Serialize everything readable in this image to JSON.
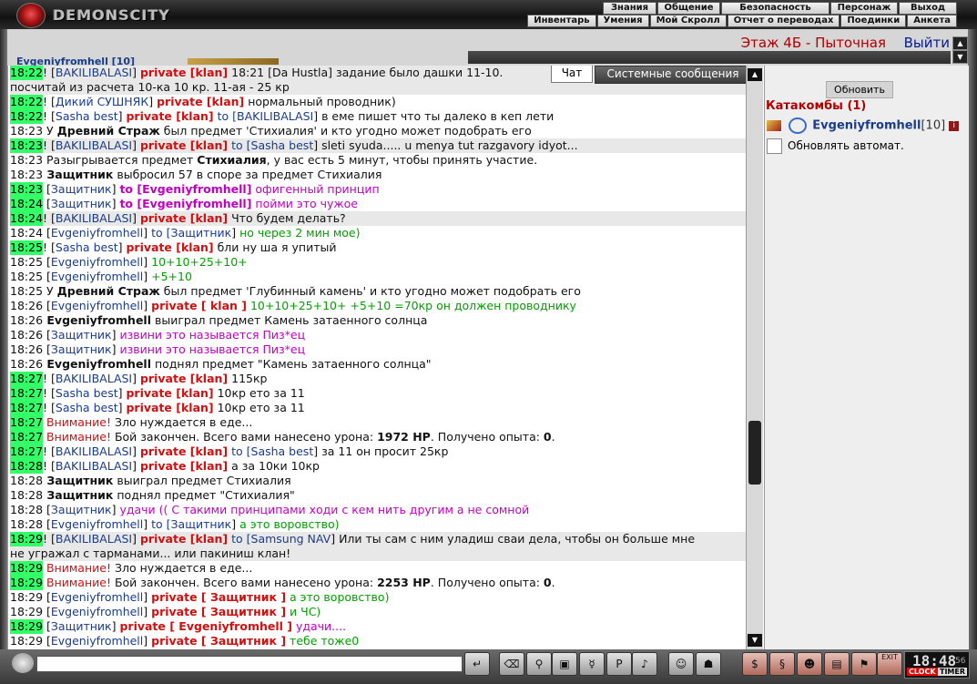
{
  "header": {
    "logo_text": "DEMONSCITY",
    "menu_top": [
      "Знания",
      "Общение",
      "Безопасность",
      "Персонаж",
      "Выход"
    ],
    "menu_bottom": [
      "Инвентарь",
      "Умения",
      "Мой Скролл",
      "Отчет о переводах",
      "Поединки",
      "Анкета"
    ],
    "user_line": "Evgeniyfromhell [10]",
    "location_title": "Этаж 4Б - Пыточная",
    "exit_label": "Выйти"
  },
  "tabs": {
    "chat": "Чат",
    "system": "Системные сообщения"
  },
  "chat": [
    {
      "hl": true,
      "alt": true,
      "parts": [
        [
          "t",
          "18:22"
        ],
        [
          "",
          "! ["
        ],
        [
          "nk",
          "BAKILIBALASI"
        ],
        [
          "",
          "] "
        ],
        [
          "pv",
          "private [klan]"
        ],
        [
          "",
          " 18:21 [Da Hustla] задание было дашки 11-10."
        ]
      ]
    },
    {
      "hl": false,
      "alt": true,
      "parts": [
        [
          "",
          "посчитай из расчета 10-ка 10 кр. 11-ая - 25 кр"
        ]
      ]
    },
    {
      "hl": true,
      "alt": false,
      "parts": [
        [
          "t",
          "18:22"
        ],
        [
          "",
          "! ["
        ],
        [
          "nk",
          "Дикий СУШНЯК"
        ],
        [
          "",
          "] "
        ],
        [
          "pv",
          "private [klan]"
        ],
        [
          "",
          " нормальный проводник)"
        ]
      ]
    },
    {
      "hl": true,
      "alt": false,
      "parts": [
        [
          "t",
          "18:22"
        ],
        [
          "",
          "! ["
        ],
        [
          "nk",
          "Sasha best"
        ],
        [
          "",
          "] "
        ],
        [
          "pv",
          "private [klan]"
        ],
        [
          "to",
          " to ["
        ],
        [
          "nk",
          "BAKILIBALASI"
        ],
        [
          "",
          "] в еме пишет что ты далеко в кеп лети"
        ]
      ]
    },
    {
      "hl": false,
      "alt": false,
      "parts": [
        [
          "t",
          "18:23"
        ],
        [
          "",
          " У "
        ],
        [
          "bold",
          "Древний Страж"
        ],
        [
          "",
          " был предмет 'Стихиалия' и кто угодно может подобрать его"
        ]
      ]
    },
    {
      "hl": true,
      "alt": true,
      "parts": [
        [
          "t",
          "18:23"
        ],
        [
          "",
          "! ["
        ],
        [
          "nk",
          "BAKILIBALASI"
        ],
        [
          "",
          "] "
        ],
        [
          "pv",
          "private [klan]"
        ],
        [
          "to",
          " to ["
        ],
        [
          "nk",
          "Sasha best"
        ],
        [
          "",
          "] sleti syuda..... u menya tut razgavory idyot..."
        ]
      ]
    },
    {
      "hl": false,
      "alt": false,
      "parts": [
        [
          "t",
          "18:23"
        ],
        [
          "",
          " Разыгрывается предмет "
        ],
        [
          "bold",
          "Стихиалия"
        ],
        [
          "",
          ", у вас есть 5 минут, чтобы принять участие."
        ]
      ]
    },
    {
      "hl": false,
      "alt": false,
      "parts": [
        [
          "t",
          "18:23"
        ],
        [
          "",
          ""
        ],
        [
          "bold",
          " Защитник"
        ],
        [
          "",
          " выбросил 57 в споре за предмет Стихиалия"
        ]
      ]
    },
    {
      "hl": true,
      "alt": false,
      "parts": [
        [
          "t",
          "18:23"
        ],
        [
          "",
          " ["
        ],
        [
          "nk",
          "Защитник"
        ],
        [
          "",
          "] "
        ],
        [
          "pvm",
          "to ["
        ],
        [
          "pvm",
          "Evgeniyfromhell"
        ],
        [
          "pvm",
          "]"
        ],
        [
          "mg",
          " офигенный принцип"
        ]
      ]
    },
    {
      "hl": true,
      "alt": false,
      "parts": [
        [
          "t",
          "18:24"
        ],
        [
          "",
          " ["
        ],
        [
          "nk",
          "Защитник"
        ],
        [
          "",
          "] "
        ],
        [
          "pvm",
          "to ["
        ],
        [
          "pvm",
          "Evgeniyfromhell"
        ],
        [
          "pvm",
          "]"
        ],
        [
          "mg",
          " пойми это чужое"
        ]
      ]
    },
    {
      "hl": true,
      "alt": true,
      "parts": [
        [
          "t",
          "18:24"
        ],
        [
          "",
          "! ["
        ],
        [
          "nk",
          "BAKILIBALASI"
        ],
        [
          "",
          "] "
        ],
        [
          "pv",
          "private [klan]"
        ],
        [
          "",
          " Что будем делать?"
        ]
      ]
    },
    {
      "hl": false,
      "alt": false,
      "parts": [
        [
          "t",
          "18:24"
        ],
        [
          "",
          " ["
        ],
        [
          "nk",
          "Evgeniyfromhell"
        ],
        [
          "",
          "] "
        ],
        [
          "to",
          "to ["
        ],
        [
          "nk",
          "Защитник"
        ],
        [
          "",
          "]"
        ],
        [
          "gm",
          " но через 2 мин мое)"
        ]
      ]
    },
    {
      "hl": true,
      "alt": false,
      "parts": [
        [
          "t",
          "18:25"
        ],
        [
          "",
          "! ["
        ],
        [
          "nk",
          "Sasha best"
        ],
        [
          "",
          "] "
        ],
        [
          "pv",
          "private [klan]"
        ],
        [
          "",
          " бли ну ша я упитый"
        ]
      ]
    },
    {
      "hl": false,
      "alt": false,
      "parts": [
        [
          "t",
          "18:25"
        ],
        [
          "",
          " ["
        ],
        [
          "nk",
          "Evgeniyfromhell"
        ],
        [
          "",
          "]"
        ],
        [
          "gm",
          " 10+10+25+10+"
        ]
      ]
    },
    {
      "hl": false,
      "alt": false,
      "parts": [
        [
          "t",
          "18:25"
        ],
        [
          "",
          " ["
        ],
        [
          "nk",
          "Evgeniyfromhell"
        ],
        [
          "",
          "]"
        ],
        [
          "gm",
          " +5+10"
        ]
      ]
    },
    {
      "hl": false,
      "alt": false,
      "parts": [
        [
          "t",
          "18:25"
        ],
        [
          "",
          " У "
        ],
        [
          "bold",
          "Древний Страж"
        ],
        [
          "",
          " был предмет 'Глубинный камень' и кто угодно может подобрать его"
        ]
      ]
    },
    {
      "hl": false,
      "alt": false,
      "parts": [
        [
          "t",
          "18:26"
        ],
        [
          "",
          " ["
        ],
        [
          "nk",
          "Evgeniyfromhell"
        ],
        [
          "",
          "] "
        ],
        [
          "pv",
          "private [ klan ]"
        ],
        [
          "gm",
          " 10+10+25+10+ +5+10 =70кр он должен проводнику"
        ]
      ]
    },
    {
      "hl": false,
      "alt": false,
      "parts": [
        [
          "t",
          "18:26"
        ],
        [
          "",
          ""
        ],
        [
          "bold",
          " Evgeniyfromhell"
        ],
        [
          "",
          " выиграл предмет Камень затаенного солнца"
        ]
      ]
    },
    {
      "hl": false,
      "alt": false,
      "parts": [
        [
          "t",
          "18:26"
        ],
        [
          "",
          " ["
        ],
        [
          "nk",
          "Защитник"
        ],
        [
          "",
          "]"
        ],
        [
          "mg",
          " извини это называется Пиз*ец"
        ]
      ]
    },
    {
      "hl": false,
      "alt": false,
      "parts": [
        [
          "t",
          "18:26"
        ],
        [
          "",
          " ["
        ],
        [
          "nk",
          "Защитник"
        ],
        [
          "",
          "]"
        ],
        [
          "mg",
          " извини это называется Пиз*ец"
        ]
      ]
    },
    {
      "hl": false,
      "alt": false,
      "parts": [
        [
          "t",
          "18:26"
        ],
        [
          "",
          ""
        ],
        [
          "bold",
          " Evgeniyfromhell"
        ],
        [
          "",
          " поднял предмет \"Камень затаенного солнца\""
        ]
      ]
    },
    {
      "hl": true,
      "alt": false,
      "parts": [
        [
          "t",
          "18:27"
        ],
        [
          "",
          "! ["
        ],
        [
          "nk",
          "BAKILIBALASI"
        ],
        [
          "",
          "] "
        ],
        [
          "pv",
          "private [klan]"
        ],
        [
          "",
          " 115кр"
        ]
      ]
    },
    {
      "hl": true,
      "alt": false,
      "parts": [
        [
          "t",
          "18:27"
        ],
        [
          "",
          "! ["
        ],
        [
          "nk",
          "Sasha best"
        ],
        [
          "",
          "] "
        ],
        [
          "pv",
          "private [klan]"
        ],
        [
          "",
          " 10кр ето за 11"
        ]
      ]
    },
    {
      "hl": true,
      "alt": false,
      "parts": [
        [
          "t",
          "18:27"
        ],
        [
          "",
          "! ["
        ],
        [
          "nk",
          "Sasha best"
        ],
        [
          "",
          "] "
        ],
        [
          "pv",
          "private [klan]"
        ],
        [
          "",
          " 10кр ето за 11"
        ]
      ]
    },
    {
      "hl": true,
      "alt": false,
      "parts": [
        [
          "t",
          "18:27"
        ],
        [
          "red",
          " Внимание!"
        ],
        [
          "",
          " Зло нуждается в еде..."
        ]
      ]
    },
    {
      "hl": true,
      "alt": false,
      "parts": [
        [
          "t",
          "18:27"
        ],
        [
          "red",
          " Внимание!"
        ],
        [
          "",
          " Бой закончен. Всего вами нанесено урона: "
        ],
        [
          "bold",
          "1972 HP"
        ],
        [
          "",
          ". Получено опыта: "
        ],
        [
          "bold",
          "0"
        ],
        [
          "",
          "."
        ]
      ]
    },
    {
      "hl": true,
      "alt": false,
      "parts": [
        [
          "t",
          "18:27"
        ],
        [
          "",
          "! ["
        ],
        [
          "nk",
          "BAKILIBALASI"
        ],
        [
          "",
          "] "
        ],
        [
          "pv",
          "private [klan]"
        ],
        [
          "to",
          " to ["
        ],
        [
          "nk",
          "Sasha best"
        ],
        [
          "",
          "] за 11 он просит 25кр"
        ]
      ]
    },
    {
      "hl": true,
      "alt": false,
      "parts": [
        [
          "t",
          "18:28"
        ],
        [
          "",
          "! ["
        ],
        [
          "nk",
          "BAKILIBALASI"
        ],
        [
          "",
          "] "
        ],
        [
          "pv",
          "private [klan]"
        ],
        [
          "",
          " а за 10ки 10кр"
        ]
      ]
    },
    {
      "hl": false,
      "alt": false,
      "parts": [
        [
          "t",
          "18:28"
        ],
        [
          "",
          ""
        ],
        [
          "bold",
          " Защитник"
        ],
        [
          "",
          " выиграл предмет Стихиалия"
        ]
      ]
    },
    {
      "hl": false,
      "alt": false,
      "parts": [
        [
          "t",
          "18:28"
        ],
        [
          "",
          ""
        ],
        [
          "bold",
          " Защитник"
        ],
        [
          "",
          " поднял предмет \"Стихиалия\""
        ]
      ]
    },
    {
      "hl": false,
      "alt": false,
      "parts": [
        [
          "t",
          "18:28"
        ],
        [
          "",
          " ["
        ],
        [
          "nk",
          "Защитник"
        ],
        [
          "",
          "]"
        ],
        [
          "mg",
          " удачи (( С такими принципами ходи с кем нить другим а не сомной"
        ]
      ]
    },
    {
      "hl": false,
      "alt": false,
      "parts": [
        [
          "t",
          "18:28"
        ],
        [
          "",
          " ["
        ],
        [
          "nk",
          "Evgeniyfromhell"
        ],
        [
          "",
          "] "
        ],
        [
          "to",
          "to ["
        ],
        [
          "nk",
          "Защитник"
        ],
        [
          "",
          "]"
        ],
        [
          "gm",
          " а это воровство)"
        ]
      ]
    },
    {
      "hl": true,
      "alt": true,
      "parts": [
        [
          "t",
          "18:29"
        ],
        [
          "",
          "! ["
        ],
        [
          "nk",
          "BAKILIBALASI"
        ],
        [
          "",
          "] "
        ],
        [
          "pv",
          "private [klan]"
        ],
        [
          "to",
          " to ["
        ],
        [
          "nk",
          "Samsung NAV"
        ],
        [
          "",
          "] Или ты сам с ним уладиш сваи дела, чтобы он больше мне"
        ]
      ]
    },
    {
      "hl": false,
      "alt": true,
      "parts": [
        [
          "",
          "не угражал с тарманами... или пакиниш клан!"
        ]
      ]
    },
    {
      "hl": true,
      "alt": false,
      "parts": [
        [
          "t",
          "18:29"
        ],
        [
          "red",
          " Внимание!"
        ],
        [
          "",
          " Зло нуждается в еде..."
        ]
      ]
    },
    {
      "hl": true,
      "alt": false,
      "parts": [
        [
          "t",
          "18:29"
        ],
        [
          "red",
          " Внимание!"
        ],
        [
          "",
          " Бой закончен. Всего вами нанесено урона: "
        ],
        [
          "bold",
          "2253 HP"
        ],
        [
          "",
          ". Получено опыта: "
        ],
        [
          "bold",
          "0"
        ],
        [
          "",
          "."
        ]
      ]
    },
    {
      "hl": false,
      "alt": false,
      "parts": [
        [
          "t",
          "18:29"
        ],
        [
          "",
          " ["
        ],
        [
          "nk",
          "Evgeniyfromhell"
        ],
        [
          "",
          "] "
        ],
        [
          "pv",
          "private [ Защитник ]"
        ],
        [
          "gm",
          " а это воровство)"
        ]
      ]
    },
    {
      "hl": false,
      "alt": false,
      "parts": [
        [
          "t",
          "18:29"
        ],
        [
          "",
          " ["
        ],
        [
          "nk",
          "Evgeniyfromhell"
        ],
        [
          "",
          "] "
        ],
        [
          "pv",
          "private [ Защитник ]"
        ],
        [
          "gm",
          " и ЧС)"
        ]
      ]
    },
    {
      "hl": true,
      "alt": false,
      "parts": [
        [
          "t",
          "18:29"
        ],
        [
          "",
          " ["
        ],
        [
          "nk",
          "Защитник"
        ],
        [
          "",
          "] "
        ],
        [
          "pv",
          "private [ Evgeniyfromhell ]"
        ],
        [
          "mg",
          " удачи...."
        ]
      ]
    },
    {
      "hl": false,
      "alt": false,
      "parts": [
        [
          "t",
          "18:29"
        ],
        [
          "",
          " ["
        ],
        [
          "nk",
          "Evgeniyfromhell"
        ],
        [
          "",
          "] "
        ],
        [
          "pv",
          "private [ Защитник ]"
        ],
        [
          "gm",
          " тебе тоже0"
        ]
      ]
    }
  ],
  "right_panel": {
    "refresh_label": "Обновить",
    "location_name": "Катакомбы (1)",
    "player_name": "Evgeniyfromhell",
    "player_level": "[10]",
    "info_glyph": "i",
    "auto_refresh_label": "Обновлять автомат."
  },
  "bottom": {
    "clock_time": "18:48",
    "clock_seconds": "56",
    "clock_label": "CLOCK",
    "timer_label": "TIMER",
    "exit_label": "EXIT"
  },
  "colors": {
    "accent_red": "#d01010",
    "nick_blue": "#1a3c8c",
    "highlight_green": "#33ff66"
  }
}
